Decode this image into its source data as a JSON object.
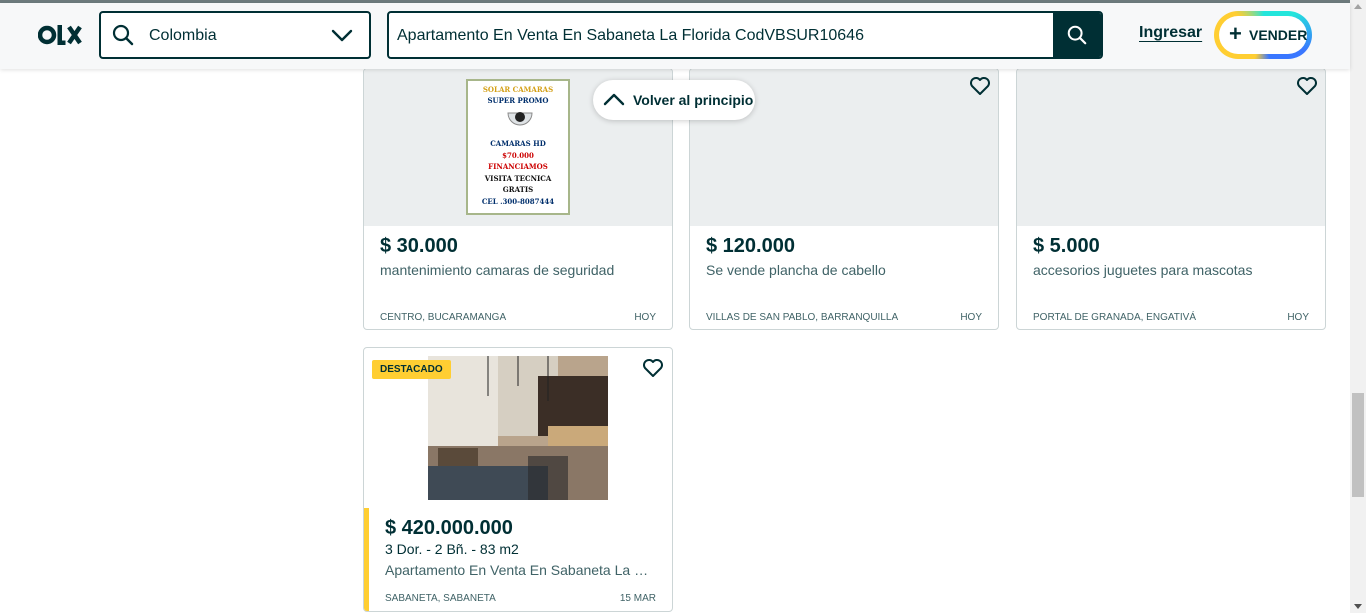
{
  "header": {
    "location_value": "Colombia",
    "search_query": "Apartamento En Venta En Sabaneta La Florida CodVBSUR10646",
    "login_label": "Ingresar",
    "sell_label": "VENDER",
    "sell_plus": "+"
  },
  "back_to_top": {
    "label": "Volver al principio"
  },
  "listings": [
    {
      "price": "$ 30.000",
      "title": "mantenimiento camaras de seguridad",
      "location": "CENTRO, BUCARAMANGA",
      "date": "HOY",
      "poster_lines": [
        "SOLAR CAMARAS",
        "SUPER PROMO",
        "CAMARAS HD",
        "$70.000",
        "FINANCIAMOS",
        "VISITA TECNICA",
        "GRATIS",
        "CEL .300-8087444"
      ]
    },
    {
      "price": "$ 120.000",
      "title": "Se vende plancha de cabello",
      "location": "VILLAS DE SAN PABLO, BARRANQUILLA",
      "date": "HOY"
    },
    {
      "price": "$ 5.000",
      "title": "accesorios juguetes para mascotas",
      "location": "PORTAL DE GRANADA, ENGATIVÁ",
      "date": "HOY"
    },
    {
      "badge": "DESTACADO",
      "price": "$ 420.000.000",
      "details": "3 Dor. - 2 Bñ. - 83 m2",
      "title": "Apartamento En Venta En Sabaneta La Fl...",
      "location": "SABANETA, SABANETA",
      "date": "15 MAR"
    }
  ],
  "colors": {
    "brand_dark": "#002f34",
    "featured_yellow": "#ffce32",
    "image_bg": "#ebeeef"
  }
}
